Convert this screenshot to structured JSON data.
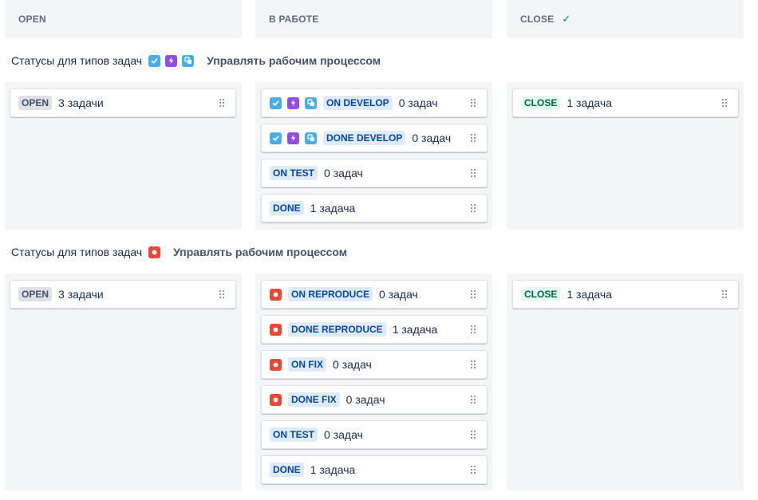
{
  "columns": [
    {
      "title": "OPEN",
      "check": false
    },
    {
      "title": "В РАБОТЕ",
      "check": false
    },
    {
      "title": "CLOSE",
      "check": true
    }
  ],
  "groups": [
    {
      "label": "Статусы для типов задач",
      "manage_link": "Управлять рабочим процессом",
      "type_icons": [
        "task-icon",
        "epic-icon",
        "subtask-icon"
      ],
      "open": [
        {
          "status": "OPEN",
          "count": "3 задачи",
          "color": "grey",
          "icons": []
        }
      ],
      "in_progress": [
        {
          "status": "ON DEVELOP",
          "count": "0 задач",
          "color": "blue",
          "icons": [
            "task-icon",
            "epic-icon",
            "subtask-icon"
          ]
        },
        {
          "status": "DONE DEVELOP",
          "count": "0 задач",
          "color": "blue",
          "icons": [
            "task-icon",
            "epic-icon",
            "subtask-icon"
          ]
        },
        {
          "status": "ON TEST",
          "count": "0 задач",
          "color": "blue",
          "icons": []
        },
        {
          "status": "DONE",
          "count": "1 задача",
          "color": "blue",
          "icons": []
        }
      ],
      "close": [
        {
          "status": "CLOSE",
          "count": "1 задача",
          "color": "green",
          "icons": []
        }
      ]
    },
    {
      "label": "Статусы для типов задач",
      "manage_link": "Управлять рабочим процессом",
      "type_icons": [
        "bug-icon"
      ],
      "open": [
        {
          "status": "OPEN",
          "count": "3 задачи",
          "color": "grey",
          "icons": []
        }
      ],
      "in_progress": [
        {
          "status": "ON REPRODUCE",
          "count": "0 задач",
          "color": "blue",
          "icons": [
            "bug-icon"
          ]
        },
        {
          "status": "DONE REPRODUCE",
          "count": "1 задача",
          "color": "blue",
          "icons": [
            "bug-icon"
          ]
        },
        {
          "status": "ON FIX",
          "count": "0 задач",
          "color": "blue",
          "icons": [
            "bug-icon"
          ]
        },
        {
          "status": "DONE FIX",
          "count": "0 задач",
          "color": "blue",
          "icons": [
            "bug-icon"
          ]
        },
        {
          "status": "ON TEST",
          "count": "0 задач",
          "color": "blue",
          "icons": []
        },
        {
          "status": "DONE",
          "count": "1 задача",
          "color": "blue",
          "icons": []
        }
      ],
      "close": [
        {
          "status": "CLOSE",
          "count": "1 задача",
          "color": "green",
          "icons": []
        }
      ]
    }
  ],
  "colors": {
    "lane_bg": "#f4f5f7",
    "open_lozenge": "#dfe1e6",
    "progress_lozenge": "#deebff",
    "close_lozenge": "#e3fcef",
    "bug": "#e5493a",
    "task": "#4bade8",
    "epic": "#904ee2"
  }
}
